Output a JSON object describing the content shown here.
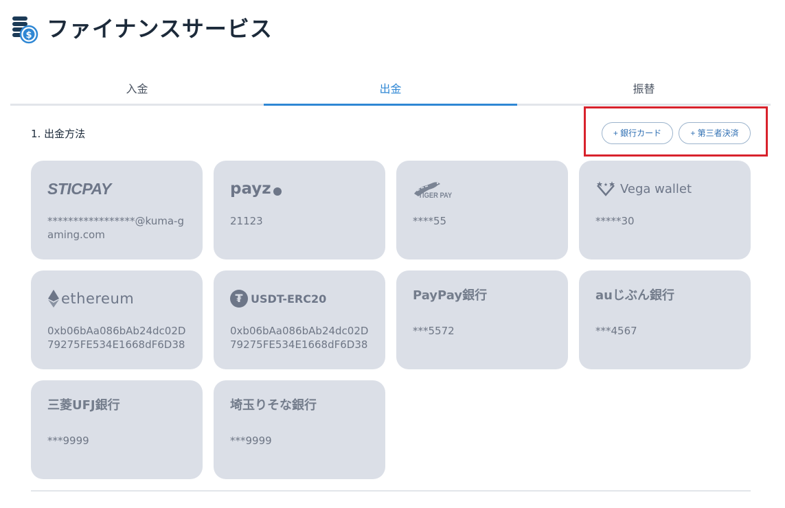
{
  "header": {
    "title": "ファイナンスサービス",
    "icon": "coins-icon"
  },
  "tabs": [
    {
      "label": "入金",
      "active": false
    },
    {
      "label": "出金",
      "active": true
    },
    {
      "label": "振替",
      "active": false
    }
  ],
  "section": {
    "title": "1. 出金方法"
  },
  "actions": {
    "add_bank_card": "+ 銀行カード",
    "add_third_party": "+ 第三者決済"
  },
  "methods": [
    {
      "logo": "STICPAY",
      "value": "*****************@kuma-gaming.com"
    },
    {
      "logo": "payz",
      "value": "21123"
    },
    {
      "logo": "TIGER PAY",
      "value": "****55"
    },
    {
      "logo": "Vega wallet",
      "value": "*****30"
    },
    {
      "logo": "ethereum",
      "value": "0xb06bAa086bAb24dc02D79275FE534E1668dF6D38"
    },
    {
      "logo": "USDT-ERC20",
      "value": "0xb06bAa086bAb24dc02D79275FE534E1668dF6D38"
    },
    {
      "logo": "PayPay銀行",
      "value": "***5572"
    },
    {
      "logo": "auじぶん銀行",
      "value": "***4567"
    },
    {
      "logo": "三菱UFJ銀行",
      "value": "***9999"
    },
    {
      "logo": "埼玉りそな銀行",
      "value": "***9999"
    }
  ],
  "colors": {
    "accent": "#2f87d4",
    "highlight": "#d8222c",
    "card_bg": "#dbdfe7"
  }
}
